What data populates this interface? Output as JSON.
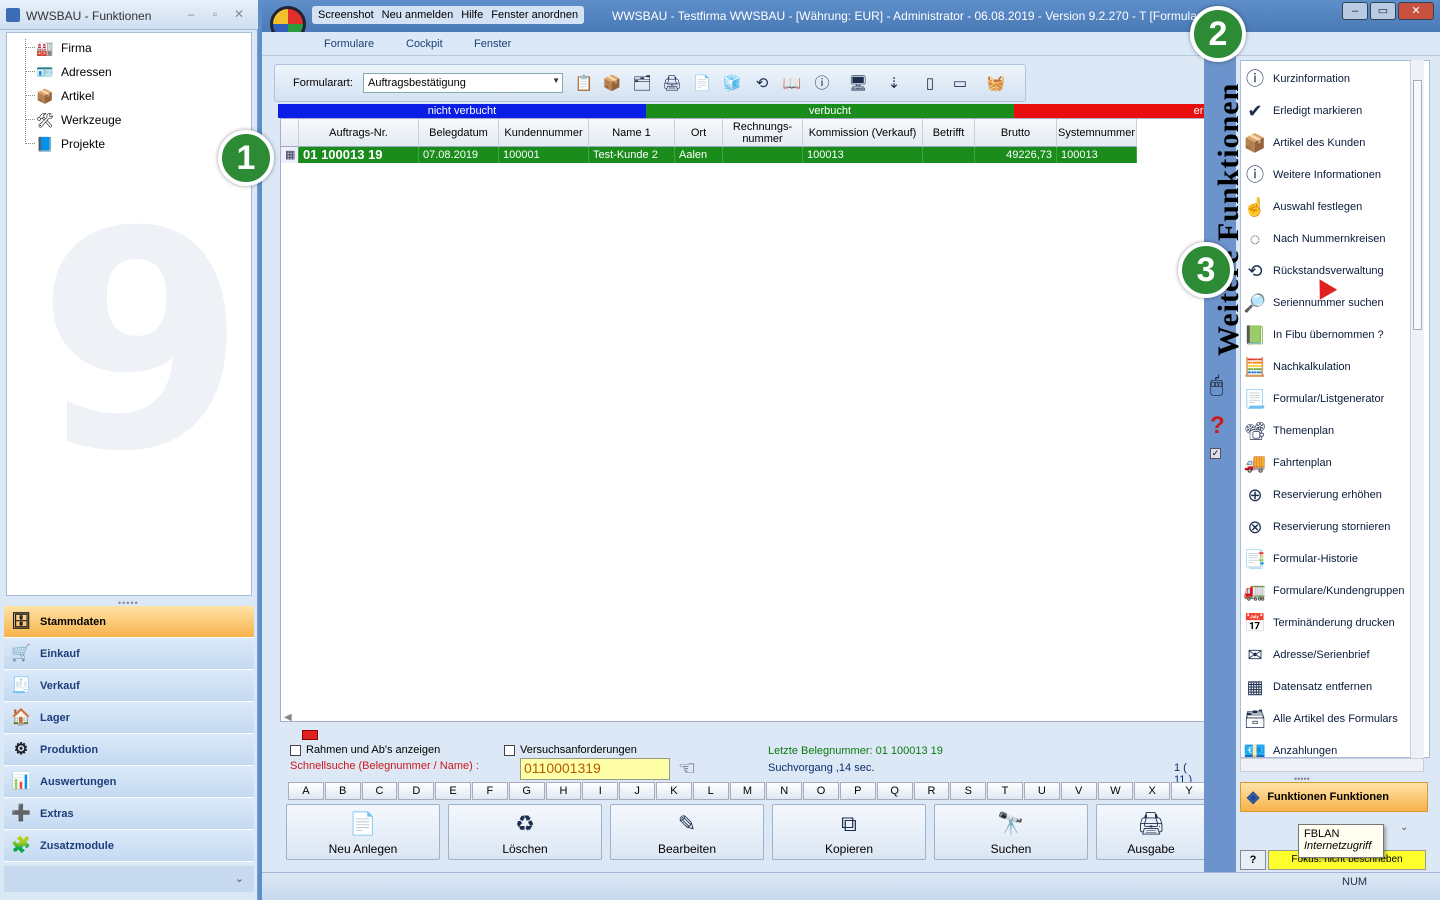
{
  "left_window": {
    "title": "WWSBAU - Funktionen",
    "tree": [
      {
        "label": "Firma",
        "icon": "factory-icon"
      },
      {
        "label": "Adressen",
        "icon": "address-card-icon"
      },
      {
        "label": "Artikel",
        "icon": "box-icon"
      },
      {
        "label": "Werkzeuge",
        "icon": "tools-icon"
      },
      {
        "label": "Projekte",
        "icon": "project-icon"
      }
    ],
    "nav": [
      {
        "label": "Stammdaten",
        "icon": "master-data-icon",
        "active": true
      },
      {
        "label": "Einkauf",
        "icon": "shopping-cart-icon",
        "active": false
      },
      {
        "label": "Verkauf",
        "icon": "cash-register-icon",
        "active": false
      },
      {
        "label": "Lager",
        "icon": "warehouse-icon",
        "active": false
      },
      {
        "label": "Produktion",
        "icon": "production-icon",
        "active": false
      },
      {
        "label": "Auswertungen",
        "icon": "analysis-icon",
        "active": false
      },
      {
        "label": "Extras",
        "icon": "extras-icon",
        "active": false
      },
      {
        "label": "Zusatzmodule",
        "icon": "modules-icon",
        "active": false
      }
    ]
  },
  "main_window": {
    "quick_access": [
      "Screenshot",
      "Neu anmelden",
      "Hilfe",
      "Fenster anordnen"
    ],
    "title": "WWSBAU - Testfirma WWSBAU - [Währung: EUR] - Administrator - 06.08.2019 - Version 9.2.270 - T",
    "title_tail": "[Formulare O",
    "menu": [
      "Formulare",
      "Cockpit",
      "Fenster"
    ],
    "toolbar": {
      "label": "Formularart:",
      "selected": "Auftragsbestätigung"
    },
    "status_legend": [
      {
        "label": "nicht verbucht",
        "color": "#0a1ee6"
      },
      {
        "label": "verbucht",
        "color": "#1a8c1c"
      },
      {
        "label": "erle",
        "color": "#e80e0e"
      }
    ],
    "table": {
      "headers": [
        "Auftrags-Nr.",
        "Belegdatum",
        "Kundennummer",
        "Name 1",
        "Ort",
        "Rechnungs-\nnummer",
        "Kommission (Verkauf)",
        "Betrifft",
        "Brutto",
        "Systemnummer"
      ],
      "rows": [
        [
          "01 100013 19",
          "07.08.2019",
          "100001",
          "Test-Kunde 2",
          "Aalen",
          "",
          "100013",
          "",
          "49226,73",
          "100013"
        ]
      ]
    },
    "options": {
      "show_frames": "Rahmen und Ab's anzeigen",
      "versuchs": "Versuchsanforderungen",
      "quicksearch_label": "Schnellsuche (Belegnummer / Name) :",
      "quicksearch_value": "0110001319",
      "last_number": "Letzte Belegnummer: 01 100013 19",
      "search_time": "Suchvorgang ,14 sec.",
      "count": "1  ( 11 )"
    },
    "alphabet": [
      "A",
      "B",
      "C",
      "D",
      "E",
      "F",
      "G",
      "H",
      "I",
      "J",
      "K",
      "L",
      "M",
      "N",
      "O",
      "P",
      "Q",
      "R",
      "S",
      "T",
      "U",
      "V",
      "W",
      "X",
      "Y"
    ],
    "actions": [
      {
        "label": "Neu Anlegen",
        "icon": "new-document-icon"
      },
      {
        "label": "Löschen",
        "icon": "recycle-bin-icon"
      },
      {
        "label": "Bearbeiten",
        "icon": "edit-icon"
      },
      {
        "label": "Kopieren",
        "icon": "copy-icon"
      },
      {
        "label": "Suchen",
        "icon": "binoculars-icon"
      },
      {
        "label": "Ausgabe",
        "icon": "printer-icon"
      }
    ],
    "status_num": "NUM"
  },
  "right_panel": {
    "vertical_title": "Weitere Funktionen",
    "functions": [
      {
        "label": "Kurzinformation",
        "icon": "info-icon"
      },
      {
        "label": "Erledigt markieren",
        "icon": "mark-done-icon"
      },
      {
        "label": "Artikel des Kunden",
        "icon": "customer-articles-icon"
      },
      {
        "label": "Weitere Informationen",
        "icon": "info-icon"
      },
      {
        "label": "Auswahl festlegen",
        "icon": "pointer-select-icon"
      },
      {
        "label": "Nach Nummernkreisen",
        "icon": "number-circle-icon"
      },
      {
        "label": "Rückstandsverwaltung",
        "icon": "backlog-clock-icon"
      },
      {
        "label": "Seriennummer suchen",
        "icon": "serial-search-icon"
      },
      {
        "label": "In Fibu übernommen ?",
        "icon": "fibu-icon"
      },
      {
        "label": "Nachkalkulation",
        "icon": "calculator-icon"
      },
      {
        "label": "Formular/Listgenerator",
        "icon": "list-generator-icon"
      },
      {
        "label": "Themenplan",
        "icon": "presentation-icon"
      },
      {
        "label": "Fahrtenplan",
        "icon": "truck-icon"
      },
      {
        "label": "Reservierung erhöhen",
        "icon": "reservation-add-icon"
      },
      {
        "label": "Reservierung stornieren",
        "icon": "reservation-cancel-icon"
      },
      {
        "label": "Formular-Historie",
        "icon": "form-history-icon"
      },
      {
        "label": "Formulare/Kundengruppen",
        "icon": "customer-groups-icon"
      },
      {
        "label": "Terminänderung drucken",
        "icon": "calendar-change-icon"
      },
      {
        "label": "Adresse/Serienbrief",
        "icon": "address-letter-icon"
      },
      {
        "label": "Datensatz entfernen",
        "icon": "remove-record-icon"
      },
      {
        "label": "Alle Artikel des Formulars",
        "icon": "all-articles-icon"
      },
      {
        "label": "Anzahlungen",
        "icon": "deposits-icon"
      }
    ],
    "footer_button": "Funktionen Funktionen",
    "tooltip_title": "FBLAN",
    "tooltip_sub": "Internetzugriff",
    "help_btn": "?",
    "yellow_text": "Fokus: nicht beschrieben"
  },
  "callouts": [
    "1",
    "2",
    "3"
  ]
}
